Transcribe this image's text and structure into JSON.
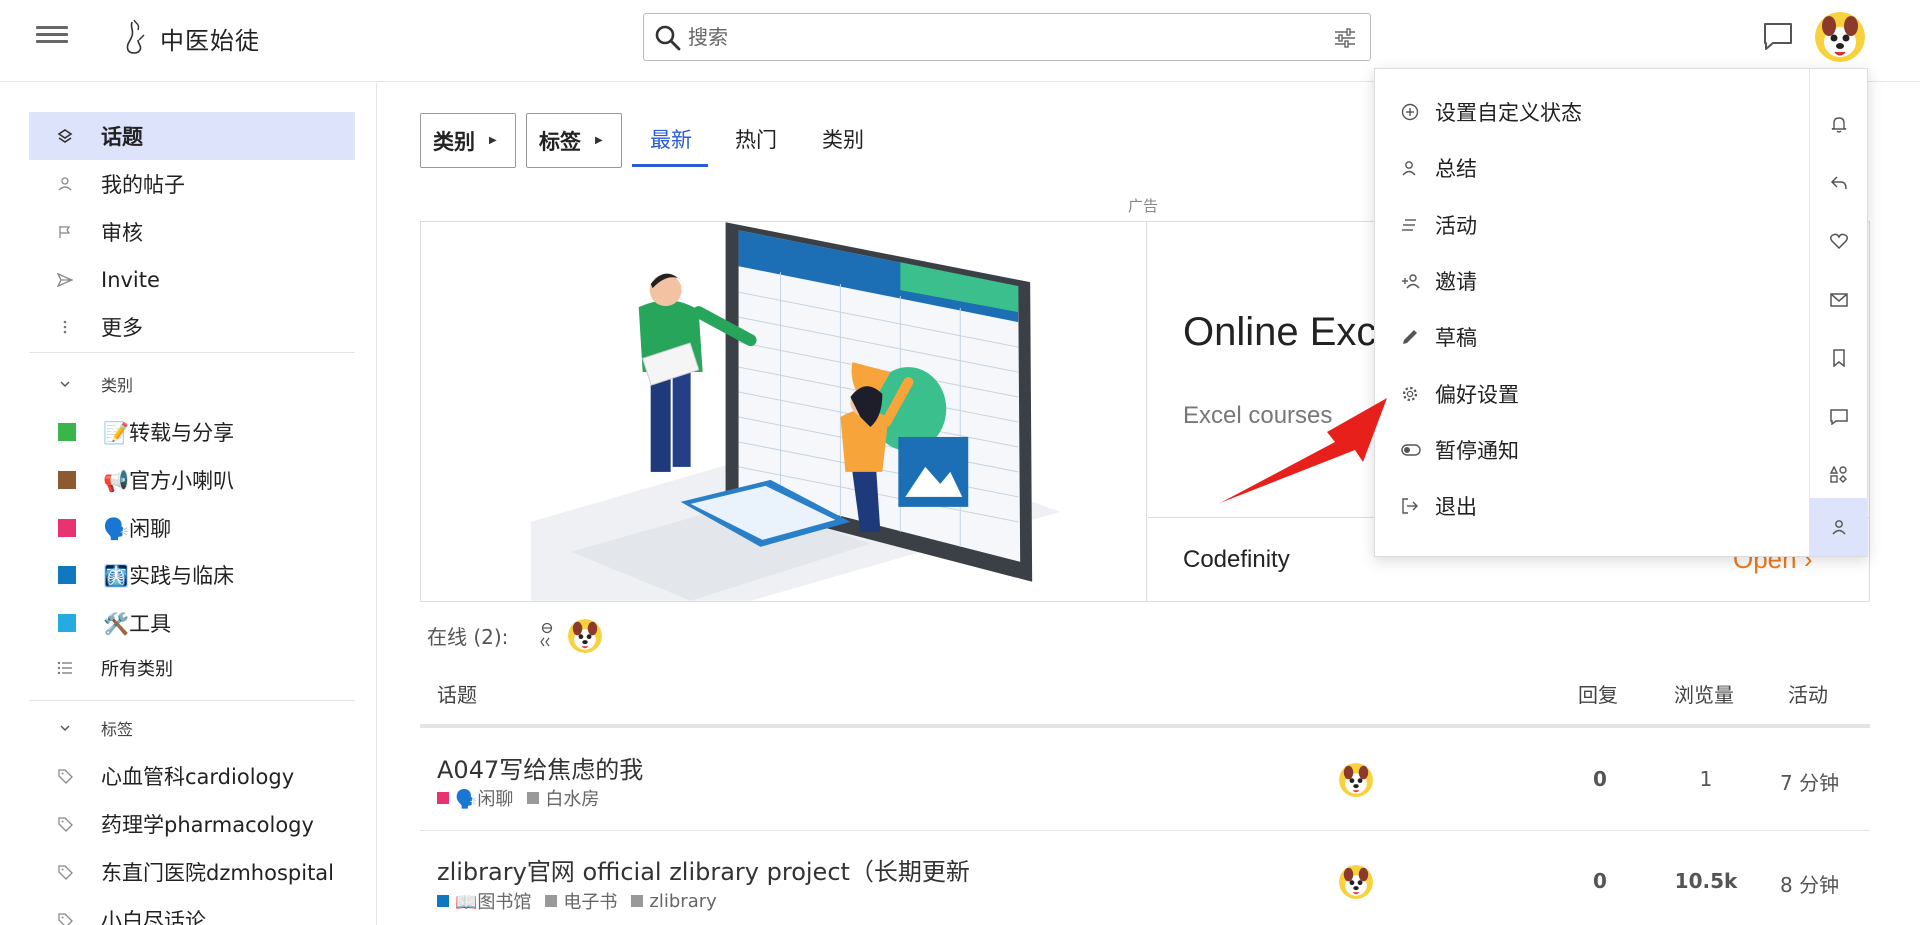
{
  "header": {
    "site_title": "中医始徒",
    "search_placeholder": "搜索"
  },
  "sidebar": {
    "items": [
      {
        "label": "话题"
      },
      {
        "label": "我的帖子"
      },
      {
        "label": "审核"
      },
      {
        "label": "Invite"
      },
      {
        "label": "更多"
      }
    ],
    "categories_header": "类别",
    "categories": [
      {
        "label": "📝转载与分享",
        "color": "#3ab54a"
      },
      {
        "label": "📢官方小喇叭",
        "color": "#8c5a2e"
      },
      {
        "label": "🗣️闲聊",
        "color": "#e8336f"
      },
      {
        "label": "🩻实践与临床",
        "color": "#0f78c1"
      },
      {
        "label": "🛠️工具",
        "color": "#25aae1"
      }
    ],
    "all_categories": "所有类别",
    "tags_header": "标签",
    "tags": [
      {
        "label": "心血管科cardiology"
      },
      {
        "label": "药理学pharmacology"
      },
      {
        "label": "东直门医院dzmhospital"
      },
      {
        "label": "小白尽话论"
      }
    ]
  },
  "nav": {
    "category_btn": "类别",
    "tag_btn": "标签",
    "tabs": [
      {
        "label": "最新"
      },
      {
        "label": "热门"
      },
      {
        "label": "类别"
      }
    ]
  },
  "ad": {
    "label": "广告",
    "title": "Online Exc",
    "subtitle": "Excel courses",
    "brand": "Codefinity",
    "open": "Open"
  },
  "online": {
    "label": "在线 (2):"
  },
  "table": {
    "headers": {
      "topic": "话题",
      "replies": "回复",
      "views": "浏览量",
      "activity": "活动"
    },
    "rows": [
      {
        "title": "A047写给焦虑的我",
        "category": "🗣️闲聊",
        "category_color": "#e8336f",
        "tags": [
          "白水房"
        ],
        "replies": "0",
        "views": "1",
        "activity": "7 分钟"
      },
      {
        "title": "zlibrary官网 official zlibrary project（长期更新",
        "category": "📖图书馆",
        "category_color": "#0f78c1",
        "tags": [
          "电子书",
          "zlibrary"
        ],
        "replies": "0",
        "views": "10.5k",
        "activity": "8 分钟"
      }
    ]
  },
  "user_menu": {
    "items": [
      {
        "label": "设置自定义状态",
        "icon": "plus-circle-icon"
      },
      {
        "label": "总结",
        "icon": "user-icon"
      },
      {
        "label": "活动",
        "icon": "stream-icon"
      },
      {
        "label": "邀请",
        "icon": "user-plus-icon"
      },
      {
        "label": "草稿",
        "icon": "pencil-icon"
      },
      {
        "label": "偏好设置",
        "icon": "gear-icon"
      },
      {
        "label": "暂停通知",
        "icon": "toggle-icon"
      },
      {
        "label": "退出",
        "icon": "sign-out-icon"
      }
    ]
  },
  "colors": {
    "accent": "#2a5cd6",
    "active_bg": "#dde3fb",
    "tag_grey": "#999999",
    "arrow_red": "#e8201c",
    "ad_orange": "#f07a1a"
  }
}
